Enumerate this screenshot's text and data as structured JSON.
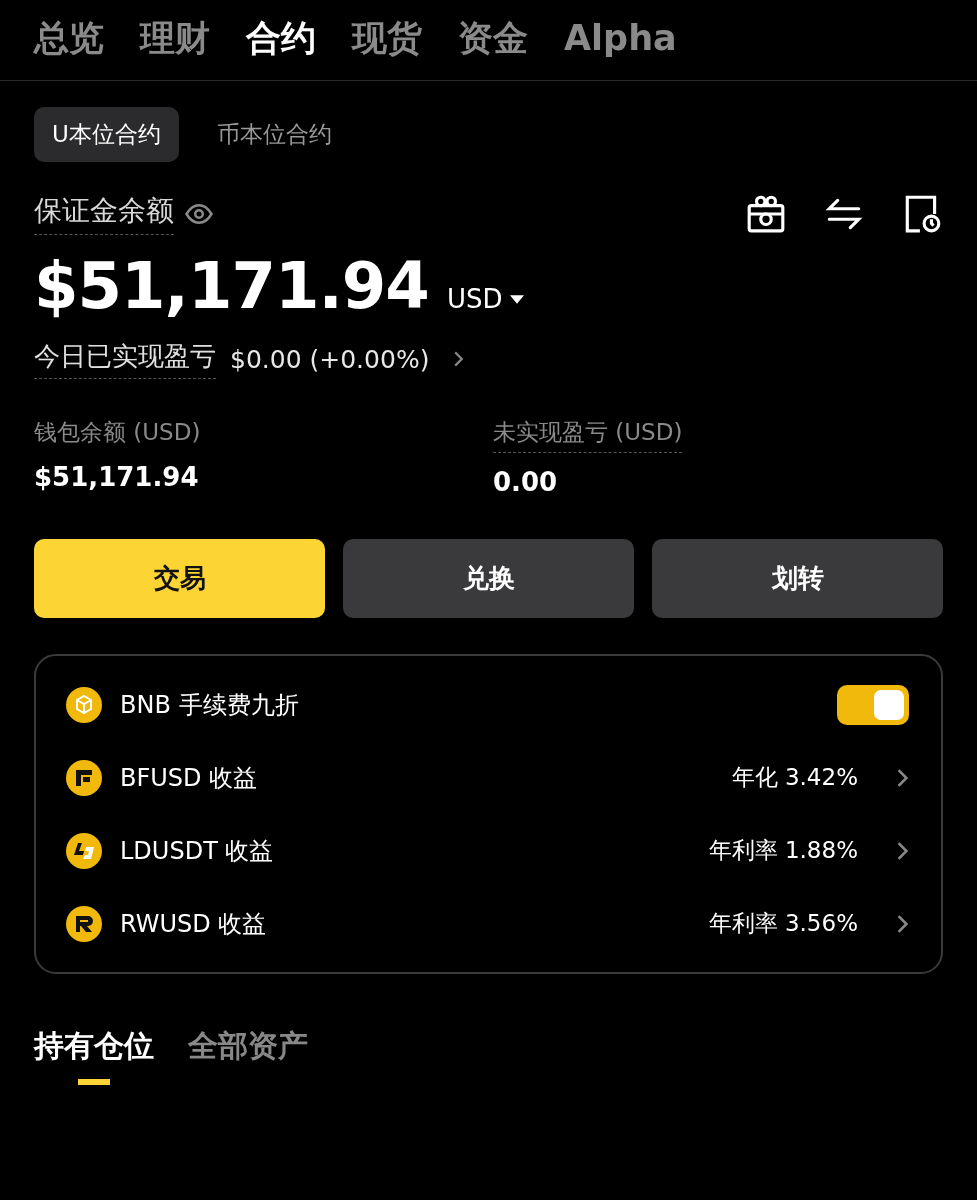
{
  "top_tabs": [
    {
      "label": "总览",
      "selected": false
    },
    {
      "label": "理财",
      "selected": false
    },
    {
      "label": "合约",
      "selected": true
    },
    {
      "label": "现货",
      "selected": false
    },
    {
      "label": "资金",
      "selected": false
    },
    {
      "label": "Alpha",
      "selected": false
    }
  ],
  "sub_tabs": [
    {
      "label": "U本位合约",
      "selected": true
    },
    {
      "label": "币本位合约",
      "selected": false
    }
  ],
  "balance": {
    "label": "保证金余额",
    "amount": "$51,171.94",
    "currency": "USD"
  },
  "pnl_today": {
    "label": "今日已实现盈亏",
    "value": "$0.00 (+0.00%)"
  },
  "stats": [
    {
      "label": "钱包余额 (USD)",
      "value": "$51,171.94",
      "underlined": false
    },
    {
      "label": "未实现盈亏 (USD)",
      "value": "0.00",
      "underlined": true
    }
  ],
  "actions": [
    {
      "label": "交易",
      "primary": true
    },
    {
      "label": "兑换",
      "primary": false
    },
    {
      "label": "划转",
      "primary": false
    }
  ],
  "card_rows": [
    {
      "kind": "toggle",
      "label": "BNB 手续费九折",
      "on": true
    },
    {
      "kind": "link",
      "label": "BFUSD 收益",
      "value": "年化 3.42%"
    },
    {
      "kind": "link",
      "label": "LDUSDT 收益",
      "value": "年利率 1.88%"
    },
    {
      "kind": "link",
      "label": "RWUSD 收益",
      "value": "年利率 3.56%"
    }
  ],
  "bottom_tabs": [
    {
      "label": "持有仓位",
      "selected": true
    },
    {
      "label": "全部资产",
      "selected": false
    }
  ]
}
